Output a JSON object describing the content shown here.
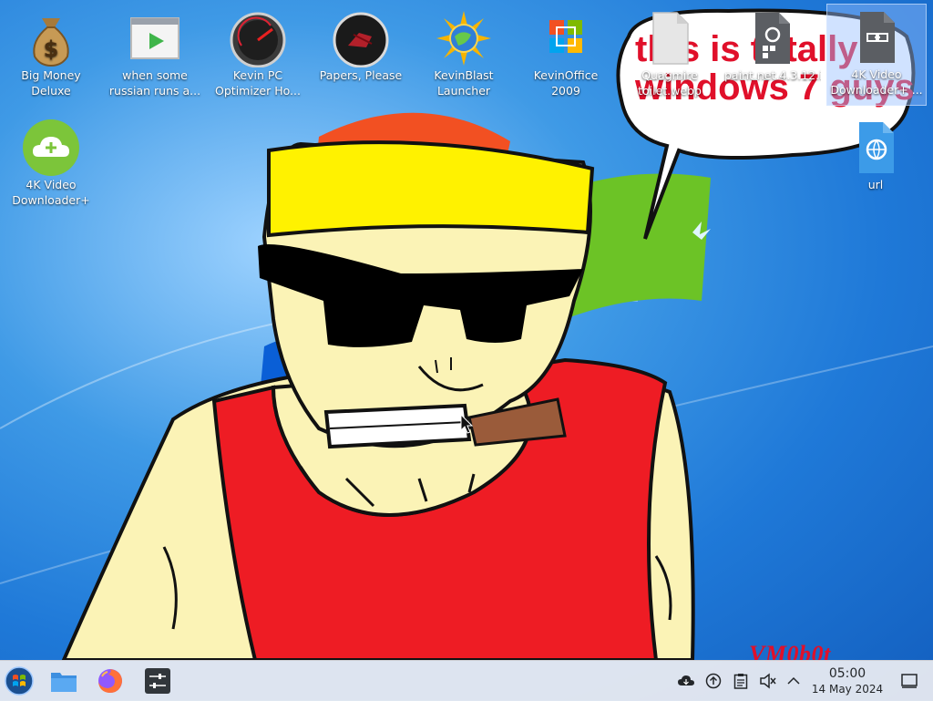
{
  "desktop": {
    "icons": [
      {
        "label": "Big Money Deluxe",
        "icon": "money-bag-icon"
      },
      {
        "label": "when some russian runs a...",
        "icon": "video-play-icon"
      },
      {
        "label": "Kevin PC Optimizer Ho...",
        "icon": "speedometer-icon"
      },
      {
        "label": "Papers, Please",
        "icon": "papers-please-icon"
      },
      {
        "label": "KevinBlast Launcher",
        "icon": "sun-globe-icon"
      },
      {
        "label": "KevinOffice 2009",
        "icon": "office-logo-icon"
      },
      {
        "label": "Quagmire toilet.webp",
        "icon": "image-file-icon"
      },
      {
        "label": "paint.net.4.3.12.install.x64.exe",
        "icon": "executable-file-icon"
      },
      {
        "label": "4K Video Downloader+ ...",
        "icon": "shortcut-file-icon",
        "selected": true
      },
      {
        "label": "4K Video Downloader+",
        "icon": "cloud-download-icon"
      },
      {
        "label": "url",
        "icon": "web-link-file-icon"
      }
    ]
  },
  "wallpaper": {
    "speech_bubble_text": [
      "this is totally",
      "windows 7 guys"
    ],
    "watermark": "VM0b0t",
    "colors": {
      "sky": "#1f79d8",
      "bandana": "#fff200",
      "tank_top": "#ee1c24",
      "skin": "#fbf3b6",
      "cigar": "#9a5b3a",
      "text_red": "#e0102a"
    }
  },
  "taskbar": {
    "start_icon": "windows-7-start-orb-icon",
    "pinned": [
      {
        "name": "file-manager",
        "icon": "folder-icon"
      },
      {
        "name": "firefox",
        "icon": "firefox-icon"
      },
      {
        "name": "system-settings",
        "icon": "sliders-icon"
      }
    ],
    "tray": [
      "cloud-sync-icon",
      "updates-icon",
      "clipboard-icon",
      "volume-muted-icon",
      "chevron-up-icon"
    ],
    "clock": {
      "time": "05:00",
      "date": "14 May 2024"
    },
    "show_desktop_icon": "show-desktop-icon"
  }
}
